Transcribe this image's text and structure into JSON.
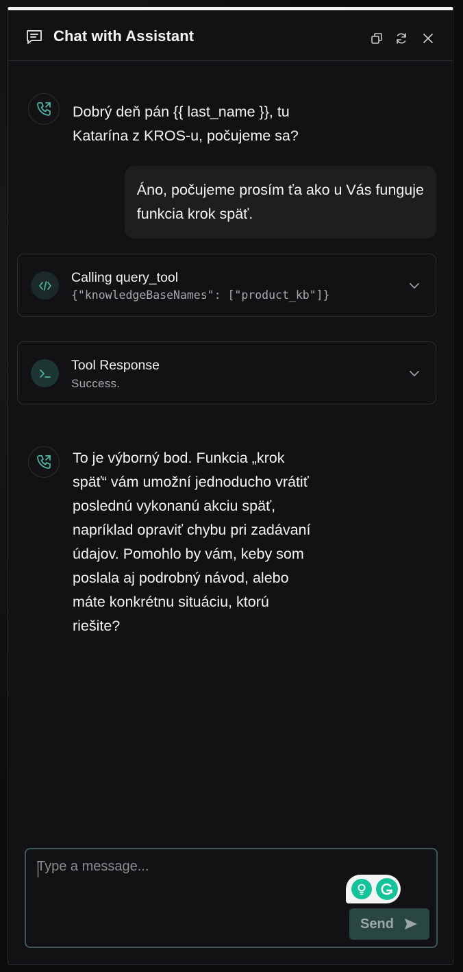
{
  "header": {
    "title": "Chat with Assistant",
    "icons": [
      "chat-icon",
      "popout-icon",
      "refresh-icon",
      "close-icon"
    ]
  },
  "messages": {
    "assistant_1": {
      "line1": "Dobrý deň pán {{ last_name }}, tu",
      "line2": "Katarína z KROS-u, počujeme sa?"
    },
    "user_1": {
      "line1": "Áno, počujeme prosím ťa ako u Vás funguje",
      "line2": "funkcia krok späť."
    },
    "tool_call": {
      "title": "Calling query_tool",
      "args": "{\"knowledgeBaseNames\": [\"product_kb\"]}"
    },
    "tool_response": {
      "title": "Tool Response",
      "status": "Success."
    },
    "assistant_2": {
      "lines": [
        "To je výborný bod. Funkcia „krok",
        "späť“ vám umožní jednoducho vrátiť",
        "poslednú vykonanú akciu späť,",
        "napríklad opraviť chybu pri zadávaní",
        "údajov. Pomohlo by vám, keby som",
        "poslala aj podrobný návod, alebo",
        "máte konkrétnu situáciu, ktorú",
        "riešite?"
      ]
    }
  },
  "composer": {
    "placeholder": "Type a message...",
    "send_label": "Send"
  },
  "colors": {
    "accent": "#4fb3a3",
    "panel": "#121214",
    "bubble": "#1e1e21",
    "send_bg": "#2a4643"
  }
}
